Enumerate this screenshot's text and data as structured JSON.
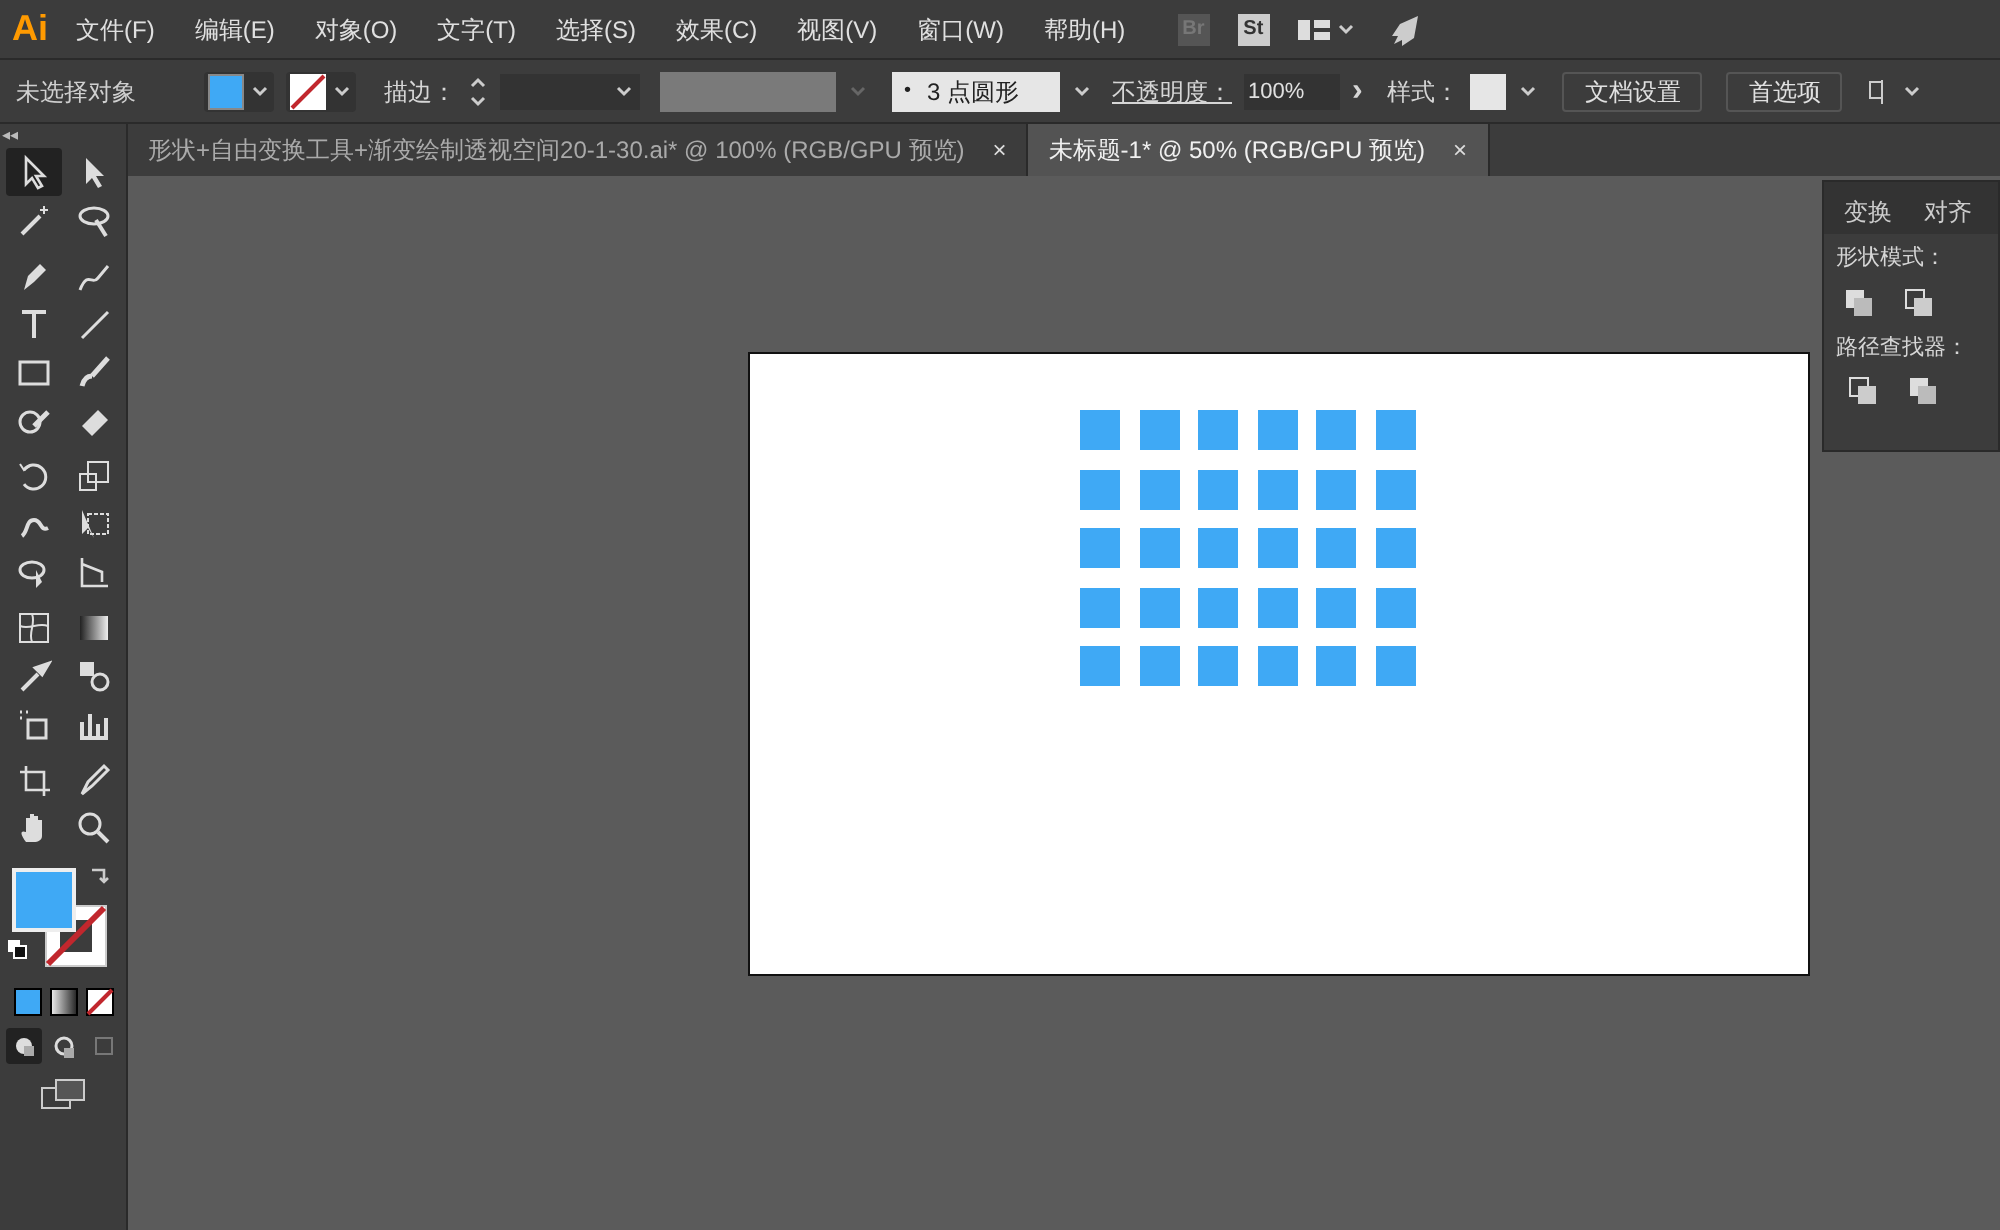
{
  "app_logo": "Ai",
  "menu": [
    "文件(F)",
    "编辑(E)",
    "对象(O)",
    "文字(T)",
    "选择(S)",
    "效果(C)",
    "视图(V)",
    "窗口(W)",
    "帮助(H)"
  ],
  "menu_icons": [
    "Br",
    "St"
  ],
  "control_bar": {
    "selection": "未选择对象",
    "stroke_label": "描边：",
    "brush": "3 点圆形",
    "brush_dot": "•",
    "opacity_label": "不透明度：",
    "opacity": "100%",
    "style_label": "样式：",
    "buttons": [
      "文档设置",
      "首选项"
    ],
    "next": "›"
  },
  "collapse": "◂◂",
  "documents": [
    {
      "title": "形状+自由变换工具+渐变绘制透视空间20-1-30.ai* @ 100% (RGB/GPU 预览)",
      "selected": false,
      "close": "×"
    },
    {
      "title": "未标题-1* @ 50% (RGB/GPU 预览)",
      "selected": true,
      "close": "×"
    }
  ],
  "tools": [
    {
      "kind": "select",
      "selected": true
    },
    {
      "kind": "direct",
      "selected": false
    },
    {
      "kind": "wand",
      "selected": false
    },
    {
      "kind": "lasso",
      "selected": false
    },
    {
      "kind": "pen",
      "selected": false
    },
    {
      "kind": "curvature",
      "selected": false
    },
    {
      "kind": "type",
      "selected": false
    },
    {
      "kind": "line",
      "selected": false
    },
    {
      "kind": "rect",
      "selected": false
    },
    {
      "kind": "brush",
      "selected": false
    },
    {
      "kind": "shaper",
      "selected": false
    },
    {
      "kind": "eraser",
      "selected": false
    },
    {
      "kind": "rotate",
      "selected": false
    },
    {
      "kind": "scale",
      "selected": false
    },
    {
      "kind": "warp",
      "selected": false
    },
    {
      "kind": "transform",
      "selected": false
    },
    {
      "kind": "shapebuilder",
      "selected": false
    },
    {
      "kind": "perspective",
      "selected": false
    },
    {
      "kind": "mesh",
      "selected": false
    },
    {
      "kind": "gradient",
      "selected": false
    },
    {
      "kind": "eyedropper",
      "selected": false
    },
    {
      "kind": "blend",
      "selected": false
    },
    {
      "kind": "symbol",
      "selected": false
    },
    {
      "kind": "graph",
      "selected": false
    },
    {
      "kind": "artboard",
      "selected": false
    },
    {
      "kind": "slice",
      "selected": false
    },
    {
      "kind": "hand",
      "selected": false
    },
    {
      "kind": "zoom",
      "selected": false
    }
  ],
  "draw_modes": [
    {
      "selected": true
    },
    {
      "selected": false
    },
    {
      "selected": false
    }
  ],
  "panel": {
    "tabs": [
      {
        "label": "变换",
        "selected": false
      },
      {
        "label": "对齐",
        "selected": false
      }
    ],
    "shape_modes": "形状模式：",
    "pathfinder": "路径查找器："
  }
}
